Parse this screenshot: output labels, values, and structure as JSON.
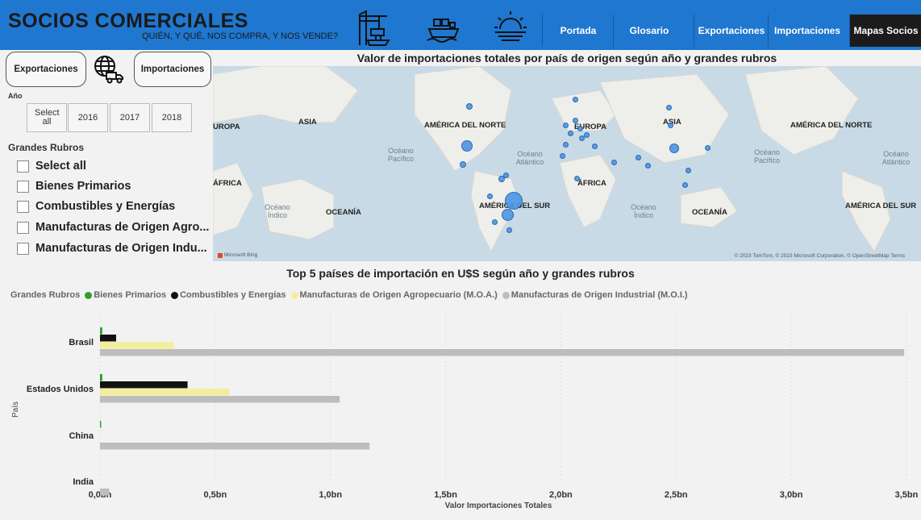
{
  "header": {
    "title": "SOCIOS COMERCIALES",
    "subtitle": "QUIÉN, Y QUÉ, NOS COMPRA, Y NOS VENDE?",
    "icons": [
      "port-crane-icon",
      "cargo-ship-icon",
      "sunrise-icon"
    ],
    "nav": [
      {
        "label": "Portada",
        "active": false
      },
      {
        "label": "Glosario",
        "active": false
      },
      {
        "label": "Exportaciones",
        "active": false
      },
      {
        "label": "Importaciones",
        "active": false
      },
      {
        "label": "Mapas Socios",
        "active": true
      }
    ]
  },
  "left_panel": {
    "exportaciones_label": "Exportaciones",
    "importaciones_label": "Importaciones",
    "year_label": "Año",
    "years": [
      "Select all",
      "2016",
      "2017",
      "2018"
    ],
    "rubros_label": "Grandes Rubros",
    "rubros": [
      "Select all",
      "Bienes Primarios",
      "Combustibles y Energías",
      "Manufacturas de Origen Agro...",
      "Manufacturas de Origen Indu..."
    ]
  },
  "map": {
    "title": "Valor de importaciones totales por país de origen según año y grandes rubros",
    "continents": [
      "UROPA",
      "ASIA",
      "AMÉRICA DEL NORTE",
      "EUROPA",
      "ASIA",
      "AMÉRICA DEL NORTE",
      "ÁFRICA",
      "ÁFRICA",
      "AMÉRICA DEL SUR",
      "OCEANÍA",
      "OCEANÍA",
      "AMÉRICA DEL SUR"
    ],
    "oceans": [
      "Océano Pacífico",
      "Océano Atlántico",
      "Océano Pacífico",
      "Océano Atlántico",
      "Océano Índico",
      "Océano Índico"
    ],
    "attribution": "© 2023 TomTom, © 2023 Microsoft Corporation, © OpenStreetMap  Terms",
    "provider": "Microsoft Bing",
    "colors": {
      "water": "#c8dae6",
      "land": "#eeeeea",
      "bubble": "#4d96e6"
    }
  },
  "chart_data": {
    "type": "bar",
    "title": "Top 5 países de importación en U$S según año y grandes rubros",
    "legend_title": "Grandes Rubros",
    "xlabel": "Valor Importaciones Totales",
    "ylabel": "País",
    "categories": [
      "Brasil",
      "Estados Unidos",
      "China",
      "India"
    ],
    "series": [
      {
        "name": "Bienes Primarios",
        "color": "#2ca02c",
        "values": [
          0.01,
          0.01,
          0.005,
          0.0
        ]
      },
      {
        "name": "Combustibles y Energías",
        "color": "#111111",
        "values": [
          0.07,
          0.38,
          0.0,
          0.0
        ]
      },
      {
        "name": "Manufacturas de Origen Agropecuario (M.O.A.)",
        "color": "#f3ee9c",
        "values": [
          0.32,
          0.56,
          0.0,
          0.0
        ]
      },
      {
        "name": "Manufacturas de Origen Industrial (M.O.I.)",
        "color": "#bdbdbd",
        "values": [
          3.49,
          1.04,
          1.17,
          0.04
        ]
      }
    ],
    "xticks": [
      "0,0bn",
      "0,5bn",
      "1,0bn",
      "1,5bn",
      "2,0bn",
      "2,5bn",
      "3,0bn",
      "3,5bn"
    ],
    "xlim": [
      0,
      3.5
    ],
    "orientation": "horizontal",
    "grid": true,
    "legend_position": "top-left"
  }
}
